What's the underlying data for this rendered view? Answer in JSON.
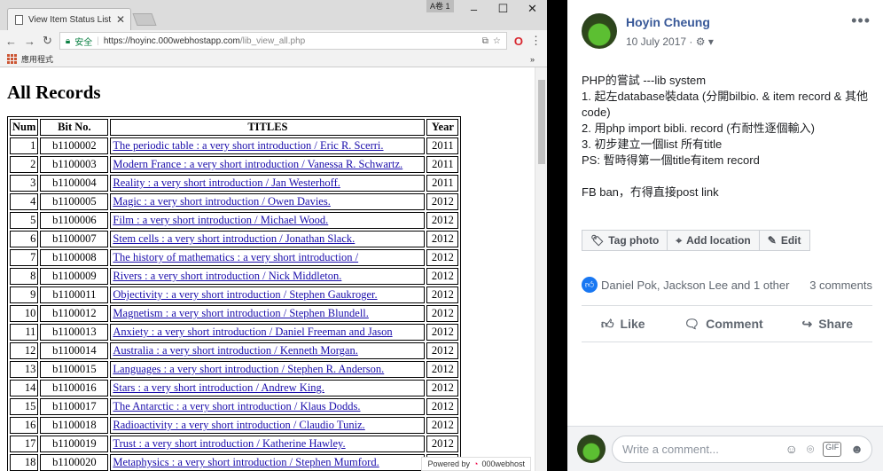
{
  "browser": {
    "tab_title": "View Item Status List",
    "user_badge": "A卷 1",
    "secure_label": "安全",
    "url_host": "https://hoyinc.000webhostapp.com",
    "url_path": "/lib_view_all.php",
    "bookmarks_label": "應用程式",
    "overflow": "»",
    "powered_by": "Powered by",
    "powered_brand": "000webhost"
  },
  "page": {
    "heading": "All Records",
    "columns": [
      "Num",
      "Bit No.",
      "TITLES",
      "Year"
    ],
    "rows": [
      {
        "num": "1",
        "bit": "b1100002",
        "title": "The periodic table : a very short introduction / Eric R. Scerri.",
        "year": "2011"
      },
      {
        "num": "2",
        "bit": "b1100003",
        "title": "Modern France : a very short introduction / Vanessa R. Schwartz.",
        "year": "2011"
      },
      {
        "num": "3",
        "bit": "b1100004",
        "title": "Reality : a very short introduction / Jan Westerhoff.",
        "year": "2011"
      },
      {
        "num": "4",
        "bit": "b1100005",
        "title": "Magic : a very short introduction / Owen Davies.",
        "year": "2012"
      },
      {
        "num": "5",
        "bit": "b1100006",
        "title": "Film : a very short introduction / Michael Wood.",
        "year": "2012"
      },
      {
        "num": "6",
        "bit": "b1100007",
        "title": "Stem cells : a very short introduction / Jonathan Slack.",
        "year": "2012"
      },
      {
        "num": "7",
        "bit": "b1100008",
        "title": "The history of mathematics : a very short introduction /",
        "year": "2012"
      },
      {
        "num": "8",
        "bit": "b1100009",
        "title": "Rivers : a very short introduction / Nick Middleton.",
        "year": "2012"
      },
      {
        "num": "9",
        "bit": "b1100011",
        "title": "Objectivity : a very short introduction / Stephen Gaukroger.",
        "year": "2012"
      },
      {
        "num": "10",
        "bit": "b1100012",
        "title": "Magnetism : a very short introduction / Stephen Blundell.",
        "year": "2012"
      },
      {
        "num": "11",
        "bit": "b1100013",
        "title": "Anxiety : a very short introduction / Daniel Freeman and Jason",
        "year": "2012"
      },
      {
        "num": "12",
        "bit": "b1100014",
        "title": "Australia : a very short introduction / Kenneth Morgan.",
        "year": "2012"
      },
      {
        "num": "13",
        "bit": "b1100015",
        "title": "Languages : a very short introduction / Stephen R. Anderson.",
        "year": "2012"
      },
      {
        "num": "14",
        "bit": "b1100016",
        "title": "Stars : a very short introduction / Andrew King.",
        "year": "2012"
      },
      {
        "num": "15",
        "bit": "b1100017",
        "title": "The Antarctic : a very short introduction / Klaus Dodds.",
        "year": "2012"
      },
      {
        "num": "16",
        "bit": "b1100018",
        "title": "Radioactivity : a very short introduction / Claudio Tuniz.",
        "year": "2012"
      },
      {
        "num": "17",
        "bit": "b1100019",
        "title": "Trust : a very short introduction / Katherine Hawley.",
        "year": "2012"
      },
      {
        "num": "18",
        "bit": "b1100020",
        "title": "Metaphysics : a very short introduction / Stephen Mumford.",
        "year": "2012"
      }
    ]
  },
  "post": {
    "author": "Hoyin Cheung",
    "date": "10 July 2017",
    "more": "•••",
    "lines": [
      "PHP的嘗試 ---lib system",
      "1. 起左database裝data (分開bilbio. & item record & 其他code)",
      "2. 用php import bibli. record (冇耐性逐個輸入)",
      "3. 初步建立一個list 所有title",
      "PS: 暫時得第一個title有item record",
      "",
      "FB ban，冇得直接post link"
    ],
    "tag_photo": "Tag photo",
    "add_location": "Add location",
    "edit": "Edit",
    "reactions_names": "Daniel Pok, Jackson Lee and 1 other",
    "comments_count": "3 comments",
    "like": "Like",
    "comment": "Comment",
    "share": "Share",
    "comment_placeholder": "Write a comment..."
  },
  "colors": {
    "link": "#1a0dab",
    "fb_blue": "#385898",
    "like_blue": "#1877f2",
    "secure_green": "#0b8043"
  }
}
